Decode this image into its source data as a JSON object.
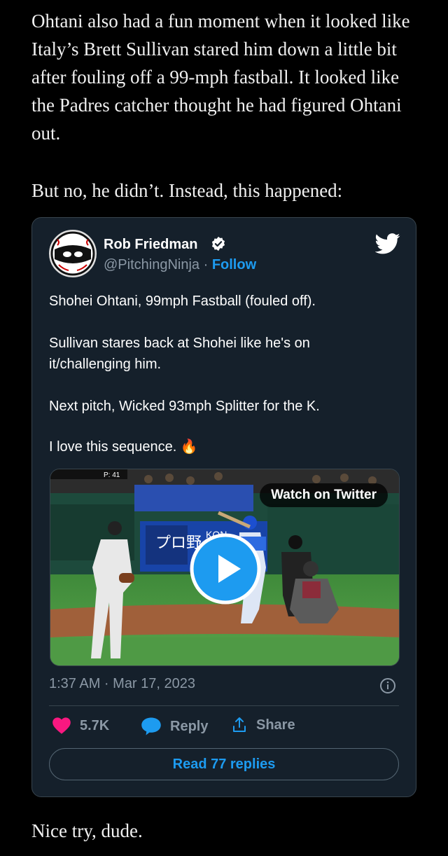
{
  "article": {
    "paragraph_1": "Ohtani also had a fun moment when it looked like Italy’s Brett Sullivan stared him down a little bit after fouling off a 99-mph fastball. It looked like the Padres catcher thought he had figured Ohtani out.",
    "paragraph_2": "But no, he didn’t. Instead, this happened:",
    "paragraph_3": "Nice try, dude."
  },
  "tweet": {
    "author_name": "Rob Friedman",
    "handle": "@PitchingNinja",
    "separator": " · ",
    "follow_label": "Follow",
    "lines": [
      "Shohei Ohtani, 99mph Fastball (fouled off).",
      "Sullivan stares back at Shohei like he's on it/challenging him.",
      "Next pitch, Wicked 93mph Splitter for the K.",
      "I love this sequence."
    ],
    "emoji": "🔥",
    "media": {
      "watch_label": "Watch on Twitter",
      "scoreboard_text": "P: 41",
      "sign_text": "プロ野",
      "kona_text": "KON"
    },
    "timestamp": "1:37 AM · Mar 17, 2023",
    "like_count": "5.7K",
    "reply_label": "Reply",
    "share_label": "Share",
    "read_replies_label": "Read 77 replies"
  },
  "colors": {
    "background": "#000000",
    "card": "#15202b",
    "accent_blue": "#1d9bf0",
    "like_red": "#f91880",
    "muted": "#8b98a5"
  },
  "icons": [
    "verified-badge-icon",
    "twitter-bird-icon",
    "play-icon",
    "info-icon",
    "heart-icon",
    "reply-bubble-icon",
    "share-icon"
  ]
}
